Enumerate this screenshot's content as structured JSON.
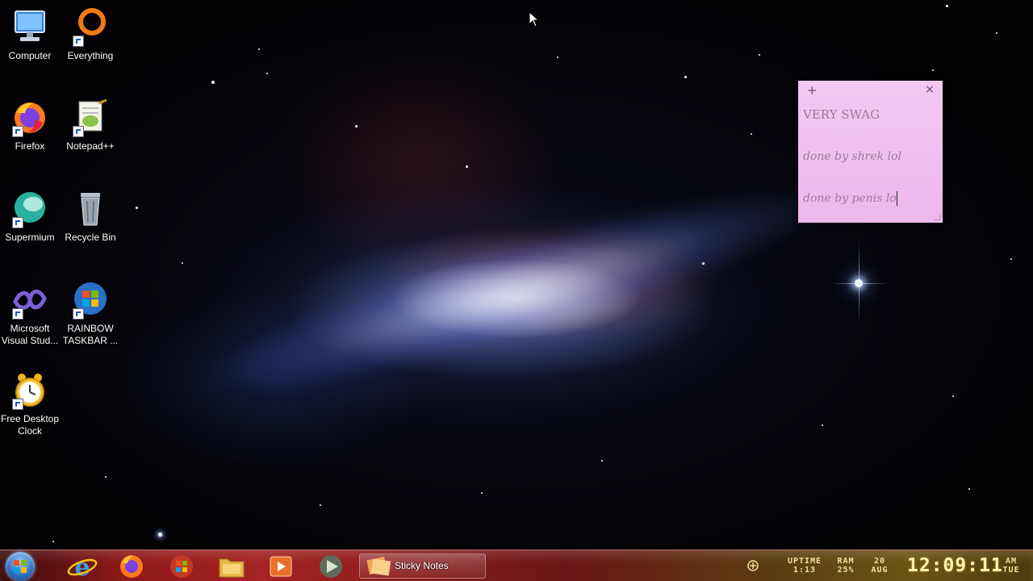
{
  "desktop": {
    "icons": [
      {
        "label": "Computer",
        "icon": "computer-icon"
      },
      {
        "label": "Everything",
        "icon": "everything-icon"
      },
      {
        "label": "Firefox",
        "icon": "firefox-icon"
      },
      {
        "label": "Notepad++",
        "icon": "notepad-plus-plus-icon"
      },
      {
        "label": "Supermium",
        "icon": "supermium-icon"
      },
      {
        "label": "Recycle Bin",
        "icon": "recycle-bin-icon"
      },
      {
        "label": "Microsoft Visual Stud...",
        "icon": "visual-studio-icon"
      },
      {
        "label": "RAINBOW TASKBAR ...",
        "icon": "rainbow-taskbar-icon"
      },
      {
        "label": "Free Desktop Clock",
        "icon": "desktop-clock-icon"
      }
    ]
  },
  "sticky_note": {
    "add_symbol": "+",
    "close_symbol": "×",
    "lines": [
      "VERY SWAG",
      "done by shrek lol",
      "done by penis lo"
    ]
  },
  "taskbar": {
    "pinned": [
      "start-orb",
      "internet-explorer-icon",
      "firefox-icon",
      "windows-media-icon",
      "file-explorer-icon",
      "media-player-icon",
      "wmp-icon"
    ],
    "active_task": {
      "label": "Sticky Notes",
      "icon": "sticky-notes-icon"
    },
    "tray": {
      "uptime_label": "UPTIME",
      "uptime_value": "1:13",
      "ram_label": "RAM",
      "ram_value": "25%",
      "date_day": "20",
      "date_month": "AUG",
      "time": "12:09:11",
      "ampm": "AM",
      "weekday": "TUE"
    }
  },
  "colors": {
    "taskbar_red": "#a52323",
    "taskbar_gold": "#6b5516",
    "sticky_pink": "#f3c8f3",
    "tray_text": "#f1e29a"
  }
}
